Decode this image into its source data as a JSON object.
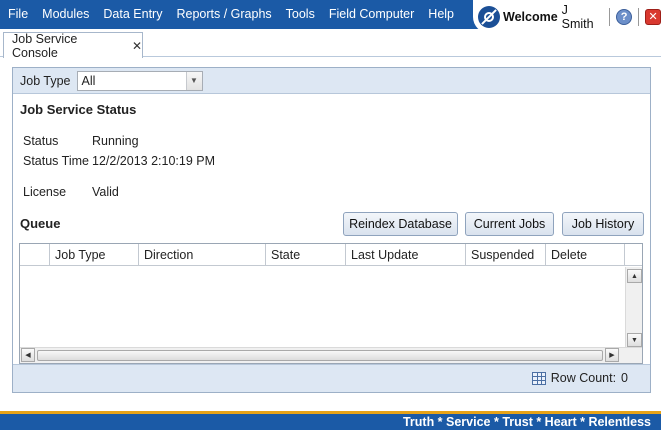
{
  "menu": [
    "File",
    "Modules",
    "Data Entry",
    "Reports / Graphs",
    "Tools",
    "Field Computer",
    "Help"
  ],
  "header": {
    "welcome_label": "Welcome",
    "user_name": "J Smith",
    "help_glyph": "?",
    "close_glyph": "✕",
    "logo_icon": "app-logo-icon"
  },
  "tab": {
    "label": "Job Service Console",
    "close_glyph": "✕"
  },
  "filter": {
    "label": "Job Type",
    "selected": "All",
    "arrow_glyph": "▼"
  },
  "status_section": {
    "title": "Job Service Status",
    "status_label": "Status",
    "status_value": "Running",
    "time_label": "Status Time",
    "time_value": "12/2/2013 2:10:19 PM",
    "license_label": "License",
    "license_value": "Valid"
  },
  "queue": {
    "title": "Queue",
    "buttons": {
      "reindex": "Reindex Database",
      "current": "Current Jobs",
      "history": "Job History"
    },
    "columns": [
      "Job Type",
      "Direction",
      "State",
      "Last Update",
      "Suspended",
      "Delete"
    ],
    "rows": [],
    "row_count_label": "Row Count:",
    "row_count": "0"
  },
  "scroll_glyphs": {
    "up": "▲",
    "down": "▼",
    "left": "◀",
    "right": "▶"
  },
  "footer": {
    "tagline": "Truth * Service * Trust * Heart * Relentless"
  },
  "colors": {
    "brand_blue": "#1b5aa6",
    "accent_gold": "#e8a317",
    "panel_bg": "#dde7f3"
  }
}
